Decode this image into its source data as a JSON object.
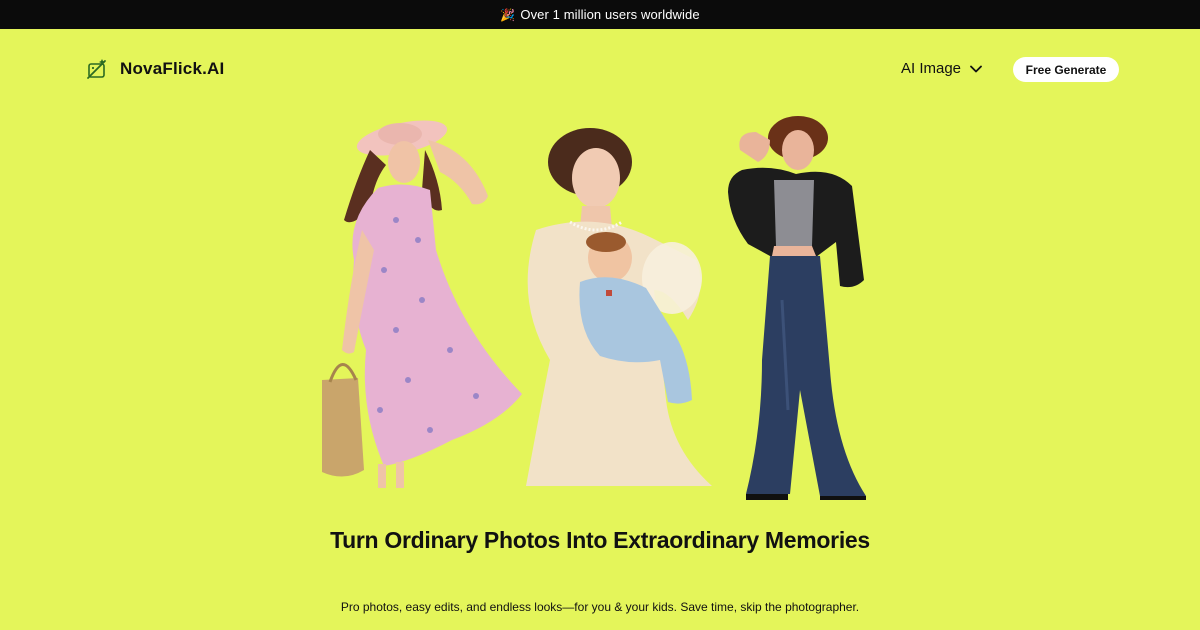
{
  "announcement": {
    "icon": "party-popper-icon",
    "text": "Over 1 million users worldwide"
  },
  "brand": {
    "icon": "magic-wand-icon",
    "name": "NovaFlick.AI"
  },
  "nav": {
    "menu_label": "AI Image",
    "menu_icon": "chevron-down-icon",
    "cta_label": "Free Generate"
  },
  "hero": {
    "images": [
      "woman-in-floral-dress-with-straw-hat-and-basket",
      "vintage-woman-in-lace-dress-holding-baby-with-angel-wings",
      "woman-in-leather-jacket-and-flared-jeans"
    ],
    "headline": "Turn Ordinary Photos Into Extraordinary Memories",
    "subheadline": "Pro photos, easy edits, and endless looks—for you & your kids. Save time, skip the photographer."
  },
  "colors": {
    "background": "#e4f55a",
    "announcement_bar": "#0b0b0b",
    "text": "#111111",
    "cta_background": "#ffffff"
  }
}
